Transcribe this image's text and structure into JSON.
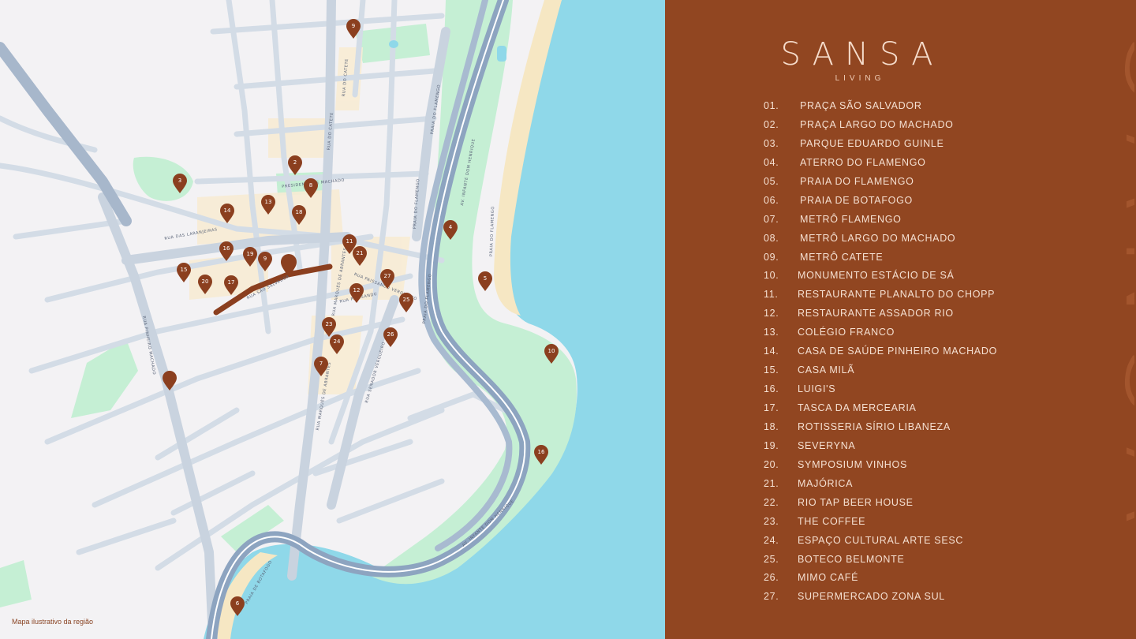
{
  "brand": {
    "name": "SANSA",
    "sub": "LIVING",
    "watermark": "SANSA"
  },
  "caption": "Mapa ilustrativo da região",
  "colors": {
    "panel": "#914621",
    "pin": "#8b3f1f",
    "water": "#8fd8e9",
    "park": "#b8ecc9",
    "road": "#cdd6e0",
    "highway": "#8da4c0",
    "sand": "#f6e7c3"
  },
  "street_labels": [
    "RUA DO CATETE",
    "RUA DO CATETE",
    "PRAIA DO FLAMENGO",
    "PRAIA DO FLAMENGO",
    "AV. INFANTE DOM HENRIQUE",
    "PRAIA DO FLAMENGO",
    "RUA DAS LARANJEIRAS",
    "RUA SÃO SALVADOR",
    "RUA PAISSANDU",
    "RUA MARQUÊS DE ABRANTES",
    "RUA PINHEIRO MACHADO",
    "RUA SENADOR VERGUEIRO",
    "RUA MARQUÊS DE ABRANTES",
    "PRAIA DO FLAMENGO",
    "AV. INFANTE DOM HENRIQUE",
    "PRAIA DE BOTAFOGO",
    "PRESIDENTE DE MACHADO",
    "RUA PAISSANDU VERGUEIRO"
  ],
  "pins": [
    "9",
    "2",
    "3",
    "8",
    "13",
    "14",
    "18",
    "16",
    "19",
    "9",
    "15",
    "20",
    "17",
    "11",
    "21",
    "27",
    "12",
    "25",
    "23",
    "26",
    "24",
    "7",
    "4",
    "5",
    "10",
    "16",
    "6"
  ],
  "places": [
    {
      "num": "01.",
      "name": "PRAÇA SÃO SALVADOR"
    },
    {
      "num": "02.",
      "name": "PRAÇA LARGO DO MACHADO"
    },
    {
      "num": "03.",
      "name": "PARQUE EDUARDO GUINLE"
    },
    {
      "num": "04.",
      "name": "ATERRO DO FLAMENGO"
    },
    {
      "num": "05.",
      "name": "PRAIA DO FLAMENGO"
    },
    {
      "num": "06.",
      "name": "PRAIA DE BOTAFOGO"
    },
    {
      "num": "07.",
      "name": "METRÔ FLAMENGO"
    },
    {
      "num": "08.",
      "name": "METRÔ LARGO DO MACHADO"
    },
    {
      "num": "09.",
      "name": "METRÔ CATETE"
    },
    {
      "num": "10.",
      "name": "MONUMENTO ESTÁCIO DE SÁ"
    },
    {
      "num": "11.",
      "name": "RESTAURANTE PLANALTO DO CHOPP"
    },
    {
      "num": "12.",
      "name": "RESTAURANTE ASSADOR RIO"
    },
    {
      "num": "13.",
      "name": "COLÉGIO FRANCO"
    },
    {
      "num": "14.",
      "name": "CASA DE SAÚDE PINHEIRO MACHADO"
    },
    {
      "num": "15.",
      "name": "CASA MILÃ"
    },
    {
      "num": "16.",
      "name": "LUIGI'S"
    },
    {
      "num": "17.",
      "name": "TASCA DA MERCEARIA"
    },
    {
      "num": "18.",
      "name": "ROTISSERIA SÍRIO LIBANEZA"
    },
    {
      "num": "19.",
      "name": "SEVERYNA"
    },
    {
      "num": "20.",
      "name": "SYMPOSIUM VINHOS"
    },
    {
      "num": "21.",
      "name": "MAJÓRICA"
    },
    {
      "num": "22.",
      "name": "RIO TAP BEER HOUSE"
    },
    {
      "num": "23.",
      "name": "THE COFFEE"
    },
    {
      "num": "24.",
      "name": "ESPAÇO CULTURAL ARTE SESC"
    },
    {
      "num": "25.",
      "name": "BOTECO BELMONTE"
    },
    {
      "num": "26.",
      "name": "MIMO CAFÉ"
    },
    {
      "num": "27.",
      "name": "SUPERMERCADO ZONA SUL"
    }
  ]
}
